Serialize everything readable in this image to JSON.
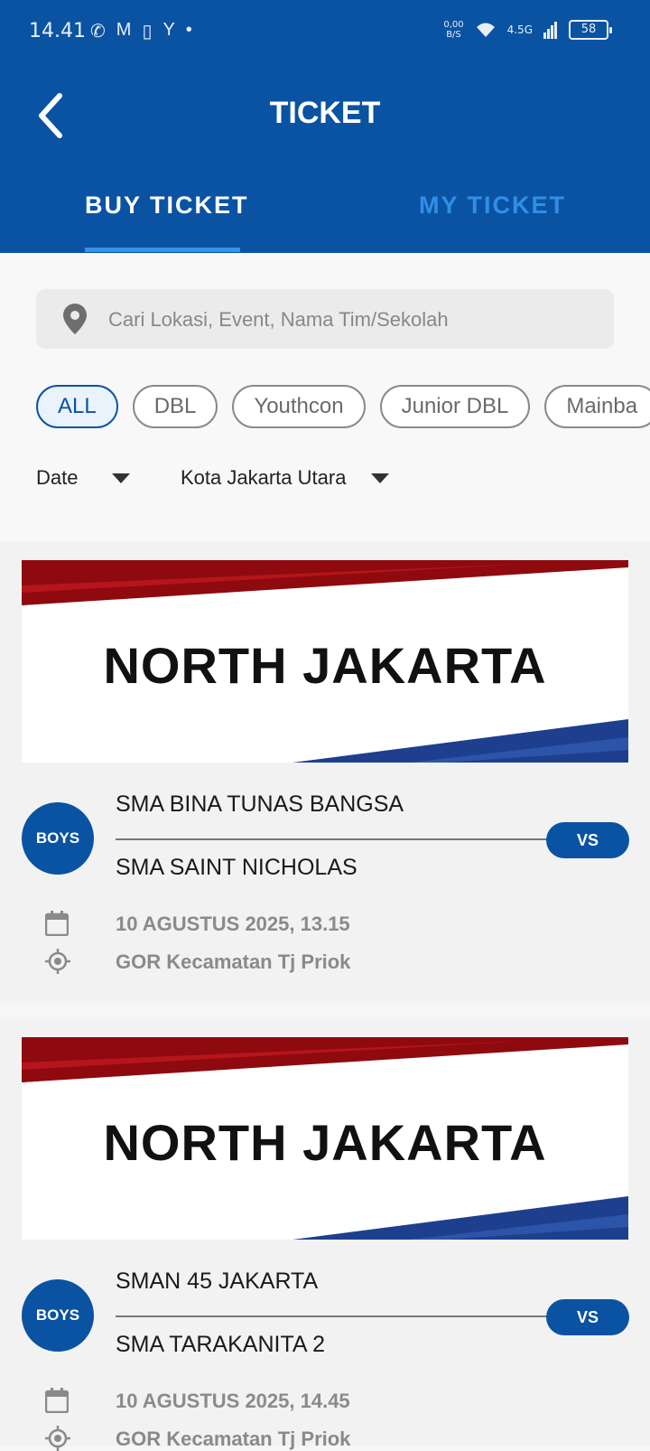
{
  "status_bar": {
    "time": "14.41",
    "speed_value": "0,00",
    "speed_unit": "B/S",
    "network": "4.5G",
    "battery": "58"
  },
  "header": {
    "title": "TICKET",
    "tabs": [
      {
        "label": "BUY TICKET",
        "active": true
      },
      {
        "label": "MY TICKET",
        "active": false
      }
    ]
  },
  "search": {
    "placeholder": "Cari Lokasi, Event, Nama Tim/Sekolah"
  },
  "chips": [
    "ALL",
    "DBL",
    "Youthcon",
    "Junior DBL",
    "Mainba"
  ],
  "filters": {
    "date_label": "Date",
    "city_label": "Kota Jakarta Utara"
  },
  "matches": [
    {
      "banner": "NORTH JAKARTA",
      "category": "BOYS",
      "team_home": "SMA BINA TUNAS BANGSA",
      "team_away": "SMA SAINT NICHOLAS",
      "vs_label": "VS",
      "datetime": "10 AGUSTUS 2025, 13.15",
      "venue": "GOR Kecamatan Tj Priok"
    },
    {
      "banner": "NORTH JAKARTA",
      "category": "BOYS",
      "team_home": "SMAN 45 JAKARTA",
      "team_away": "SMA TARAKANITA 2",
      "vs_label": "VS",
      "datetime": "10 AGUSTUS 2025, 14.45",
      "venue": "GOR Kecamatan Tj Priok"
    }
  ],
  "colors": {
    "primary": "#0a53a3",
    "tab_inactive": "#2f8fe6",
    "banner_red": "#8e0a0f",
    "banner_blue": "#1e3f8e"
  }
}
